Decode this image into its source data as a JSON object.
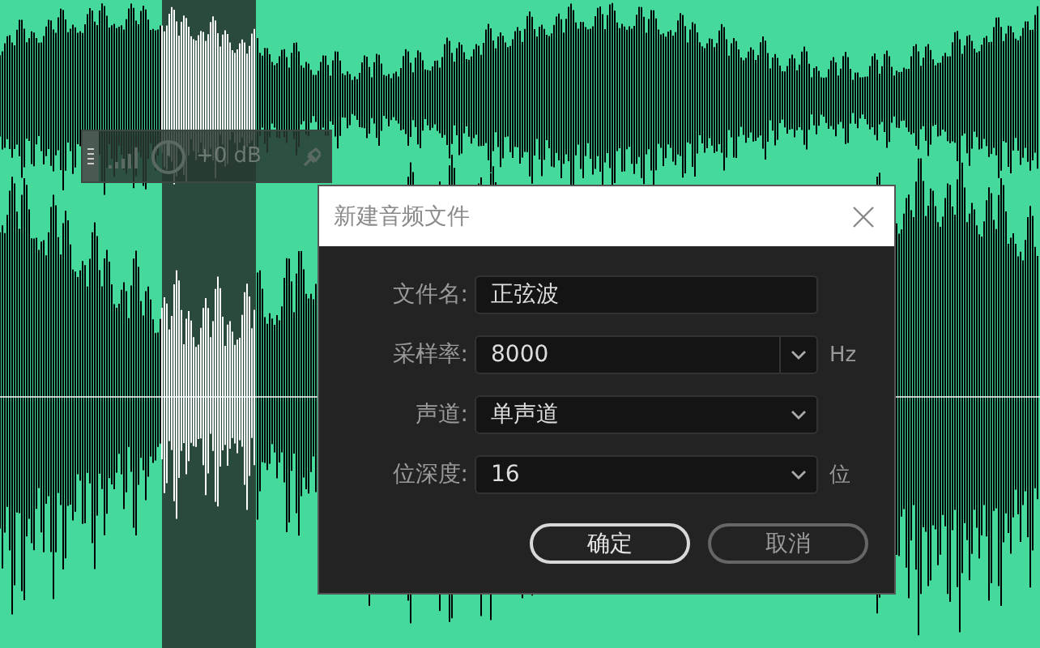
{
  "level_hud": {
    "reading": "+0 dB"
  },
  "dialog": {
    "title": "新建音频文件",
    "fields": [
      {
        "kind": "input",
        "label": "文件名:",
        "value": "正弦波"
      },
      {
        "kind": "combo",
        "label": "采样率:",
        "value": "8000",
        "unit": "Hz"
      },
      {
        "kind": "select",
        "label": "声道:",
        "value": "单声道"
      },
      {
        "kind": "select",
        "label": "位深度:",
        "value": "16",
        "unit": "位"
      }
    ],
    "buttons": [
      {
        "label": "确定",
        "kind": "default"
      },
      {
        "label": "取消",
        "kind": "normal"
      }
    ]
  }
}
